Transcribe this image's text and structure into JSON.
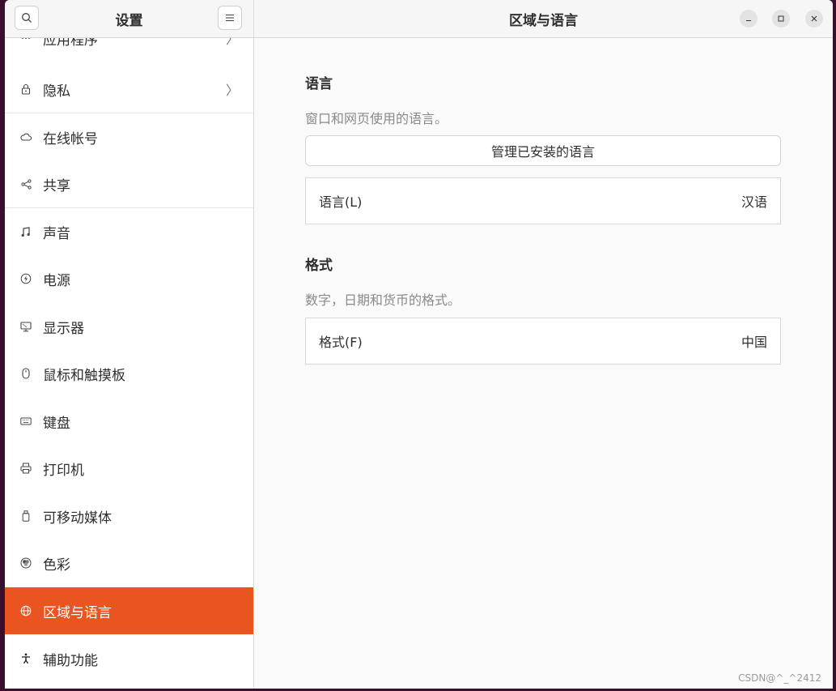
{
  "sidebar": {
    "title": "设置",
    "items": [
      {
        "label": "应用程序",
        "icon": "apps-grid-icon",
        "chevron": "〉"
      },
      {
        "label": "隐私",
        "icon": "lock-icon",
        "chevron": "〉"
      },
      {
        "label": "在线帐号",
        "icon": "cloud-icon"
      },
      {
        "label": "共享",
        "icon": "share-icon"
      },
      {
        "label": "声音",
        "icon": "music-note-icon"
      },
      {
        "label": "电源",
        "icon": "power-icon"
      },
      {
        "label": "显示器",
        "icon": "monitor-icon"
      },
      {
        "label": "鼠标和触摸板",
        "icon": "mouse-icon"
      },
      {
        "label": "键盘",
        "icon": "keyboard-icon"
      },
      {
        "label": "打印机",
        "icon": "printer-icon"
      },
      {
        "label": "可移动媒体",
        "icon": "usb-drive-icon"
      },
      {
        "label": "色彩",
        "icon": "color-icon"
      },
      {
        "label": "区域与语言",
        "icon": "globe-icon"
      },
      {
        "label": "辅助功能",
        "icon": "accessibility-icon"
      }
    ]
  },
  "main": {
    "title": "区域与语言",
    "language": {
      "title": "语言",
      "description": "窗口和网页使用的语言。",
      "manage_button": "管理已安装的语言",
      "row_label": "语言(L)",
      "row_value": "汉语"
    },
    "formats": {
      "title": "格式",
      "description": "数字，日期和货币的格式。",
      "row_label": "格式(F)",
      "row_value": "中国"
    }
  },
  "watermark": "CSDN@^_^2412",
  "colors": {
    "accent": "#e95420"
  }
}
